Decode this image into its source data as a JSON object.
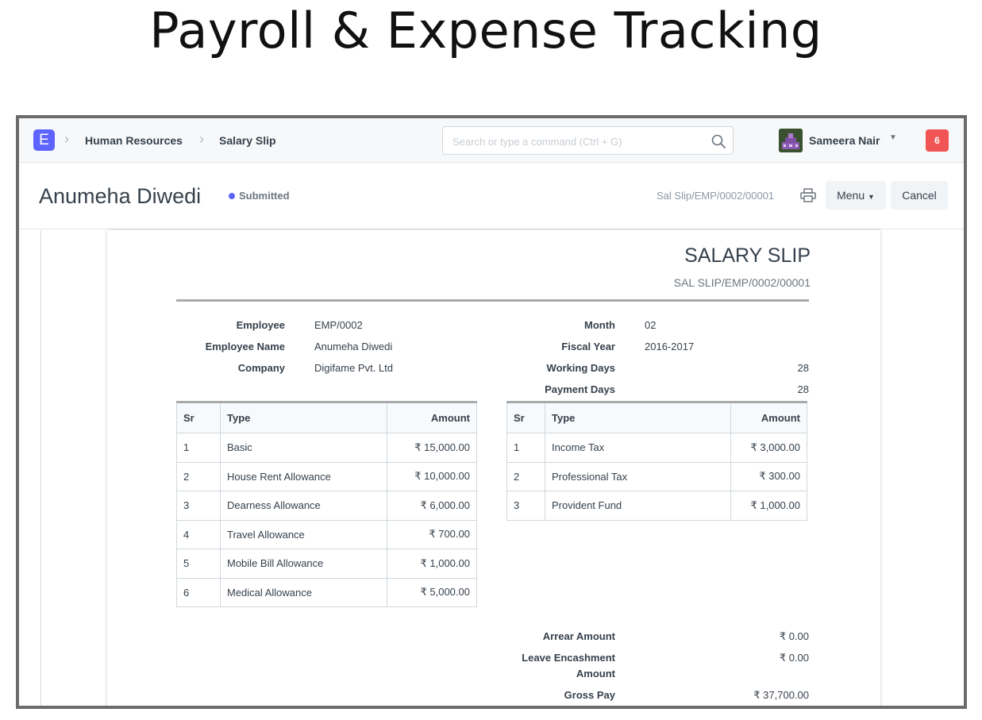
{
  "headline": "Payroll & Expense Tracking",
  "navbar": {
    "logo_letter": "E",
    "breadcrumbs": [
      "Human Resources",
      "Salary Slip"
    ],
    "search_placeholder": "Search or type a command (Ctrl + G)",
    "user_name": "Sameera Nair",
    "notification_count": "6"
  },
  "page_head": {
    "title": "Anumeha Diwedi",
    "status": "Submitted",
    "doc_id": "Sal Slip/EMP/0002/00001",
    "menu_label": "Menu",
    "cancel_label": "Cancel"
  },
  "slip": {
    "title": "SALARY SLIP",
    "id": "SAL SLIP/EMP/0002/00001",
    "left_fields": [
      {
        "label": "Employee",
        "value": "EMP/0002"
      },
      {
        "label": "Employee Name",
        "value": "Anumeha Diwedi"
      },
      {
        "label": "Company",
        "value": "Digifame Pvt. Ltd"
      }
    ],
    "right_fields": [
      {
        "label": "Month",
        "value": "02"
      },
      {
        "label": "Fiscal Year",
        "value": "2016-2017"
      },
      {
        "label": "Working Days",
        "value": "28"
      },
      {
        "label": "Payment Days",
        "value": "28"
      }
    ],
    "earnings": {
      "headers": [
        "Sr",
        "Type",
        "Amount"
      ],
      "rows": [
        [
          "1",
          "Basic",
          "₹ 15,000.00"
        ],
        [
          "2",
          "House Rent Allowance",
          "₹ 10,000.00"
        ],
        [
          "3",
          "Dearness Allowance",
          "₹ 6,000.00"
        ],
        [
          "4",
          "Travel Allowance",
          "₹ 700.00"
        ],
        [
          "5",
          "Mobile Bill Allowance",
          "₹ 1,000.00"
        ],
        [
          "6",
          "Medical Allowance",
          "₹ 5,000.00"
        ]
      ]
    },
    "deductions": {
      "headers": [
        "Sr",
        "Type",
        "Amount"
      ],
      "rows": [
        [
          "1",
          "Income Tax",
          "₹ 3,000.00"
        ],
        [
          "2",
          "Professional Tax",
          "₹ 300.00"
        ],
        [
          "3",
          "Provident Fund",
          "₹ 1,000.00"
        ]
      ]
    },
    "totals": [
      {
        "label": "Arrear Amount",
        "value": "₹ 0.00"
      },
      {
        "label": "Leave Encashment Amount",
        "value": "₹ 0.00"
      },
      {
        "label": "Gross Pay",
        "value": "₹ 37,700.00"
      }
    ]
  }
}
